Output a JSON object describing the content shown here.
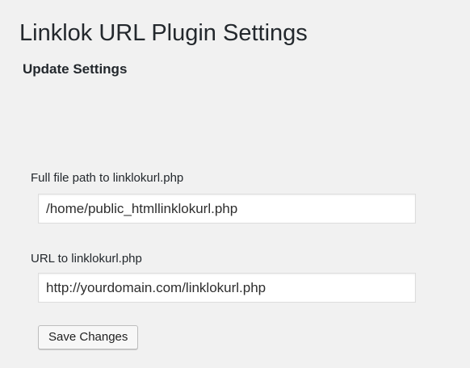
{
  "page": {
    "title": "Linklok URL Plugin Settings",
    "section_title": "Update Settings"
  },
  "form": {
    "fields": [
      {
        "label": "Full file path to linklokurl.php",
        "value": "/home/public_htmllinklokurl.php"
      },
      {
        "label": "URL to linklokurl.php",
        "value": "http://yourdomain.com/linklokurl.php"
      }
    ],
    "save_label": "Save Changes"
  },
  "colors": {
    "background": "#f1f1f1",
    "text": "#23282d",
    "input_background": "#ffffff",
    "input_border": "#dddddd"
  }
}
